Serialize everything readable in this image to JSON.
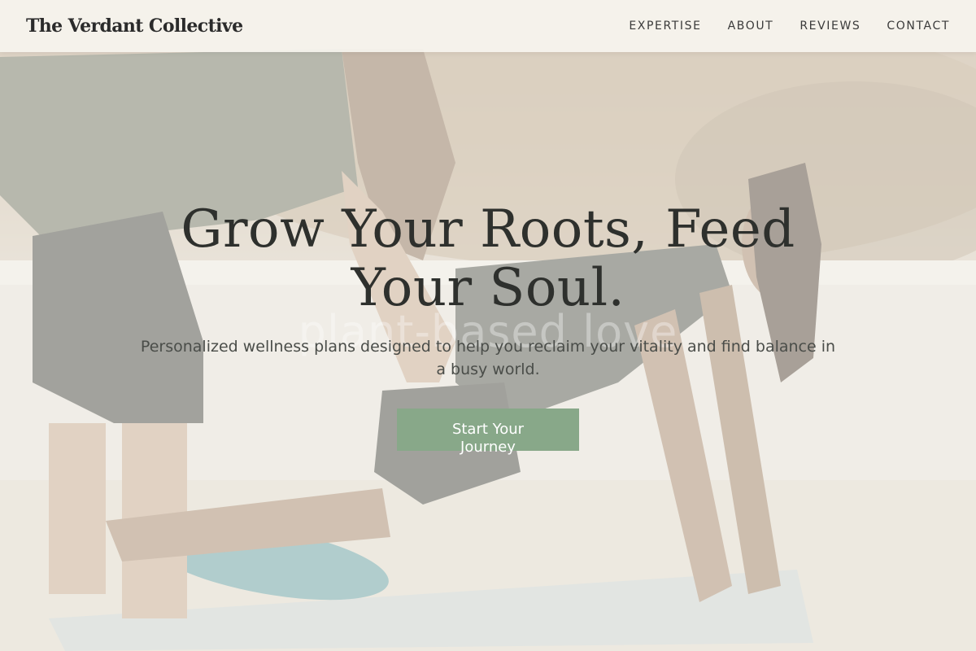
{
  "nav": {
    "brand": "The Verdant Collective",
    "links": [
      "EXPERTISE",
      "ABOUT",
      "REVIEWS",
      "CONTACT"
    ]
  },
  "hero": {
    "background_image": "two-women-yoga-stretch-outdoors",
    "headline": "Grow Your Roots, Feed Your Soul.",
    "watermark": "plant-based love",
    "subheadline": "Personalized wellness plans designed to help you reclaim your vitality and find balance in a busy world.",
    "cta_label": "Start Your Journey"
  },
  "colors": {
    "accent": "#88a889",
    "background": "#f6f4ef",
    "text_dark": "#2e302d"
  }
}
